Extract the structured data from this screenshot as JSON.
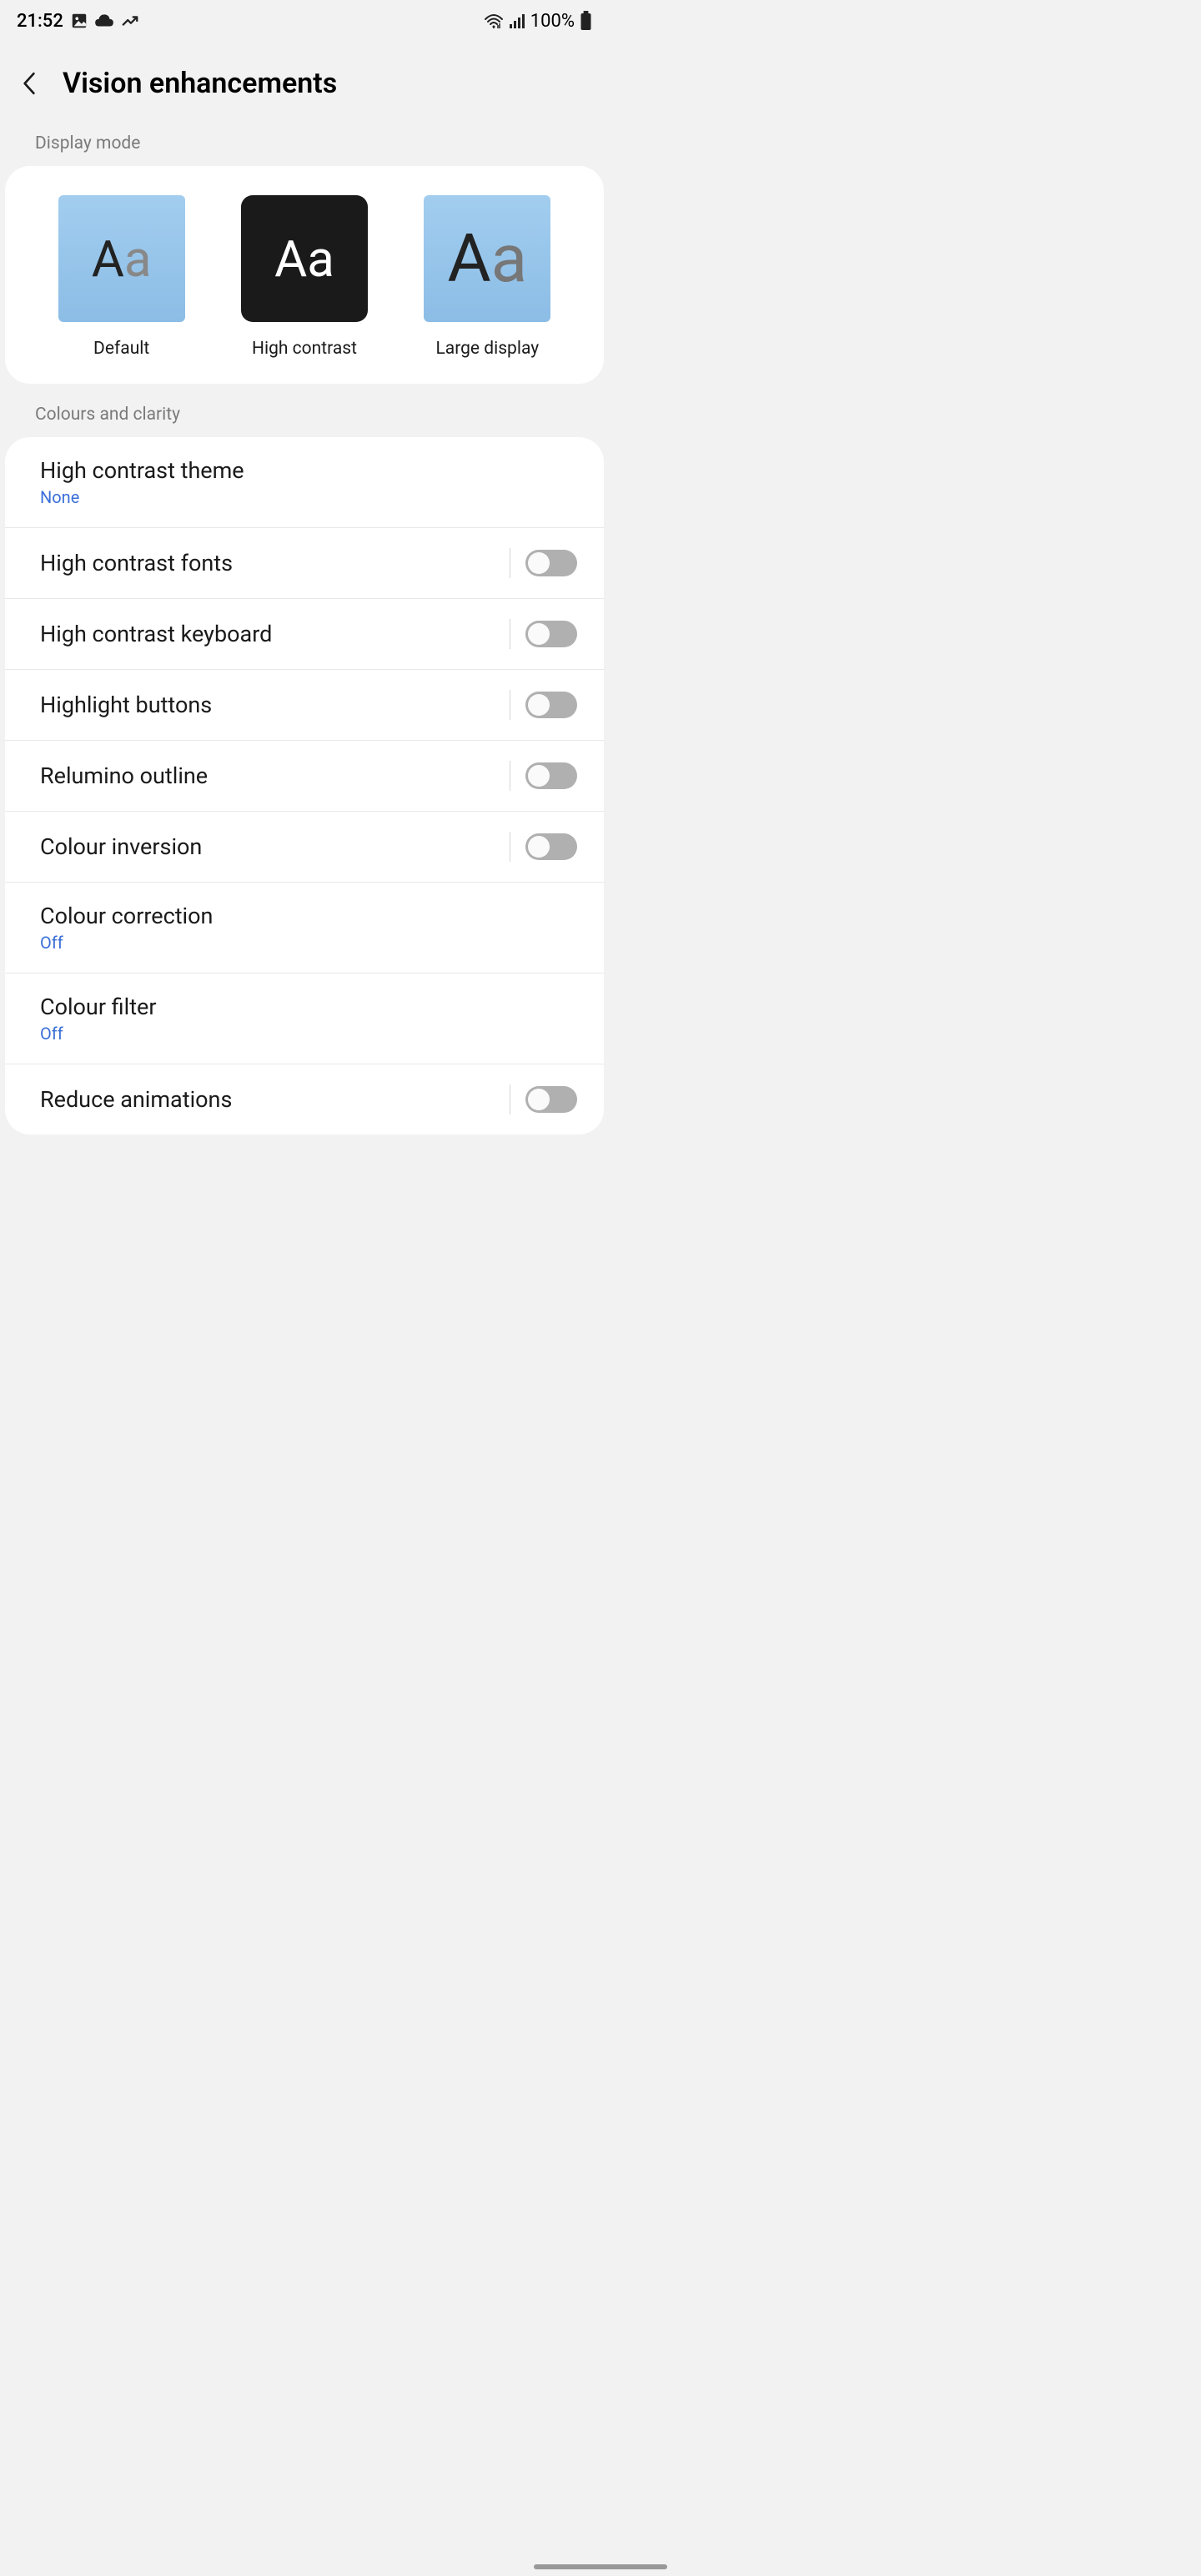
{
  "status": {
    "time": "21:52",
    "battery": "100%"
  },
  "header": {
    "title": "Vision enhancements"
  },
  "sections": {
    "display_mode": {
      "label": "Display mode",
      "options": {
        "default": "Default",
        "high_contrast": "High contrast",
        "large_display": "Large display"
      }
    },
    "colours": {
      "label": "Colours and clarity",
      "items": {
        "high_contrast_theme": {
          "title": "High contrast theme",
          "sub": "None"
        },
        "high_contrast_fonts": {
          "title": "High contrast fonts",
          "toggle": false
        },
        "high_contrast_keyboard": {
          "title": "High contrast keyboard",
          "toggle": false
        },
        "highlight_buttons": {
          "title": "Highlight buttons",
          "toggle": false
        },
        "relumino_outline": {
          "title": "Relumino outline",
          "toggle": false
        },
        "colour_inversion": {
          "title": "Colour inversion",
          "toggle": false
        },
        "colour_correction": {
          "title": "Colour correction",
          "sub": "Off"
        },
        "colour_filter": {
          "title": "Colour filter",
          "sub": "Off"
        },
        "reduce_animations": {
          "title": "Reduce animations",
          "toggle": false
        }
      }
    }
  }
}
